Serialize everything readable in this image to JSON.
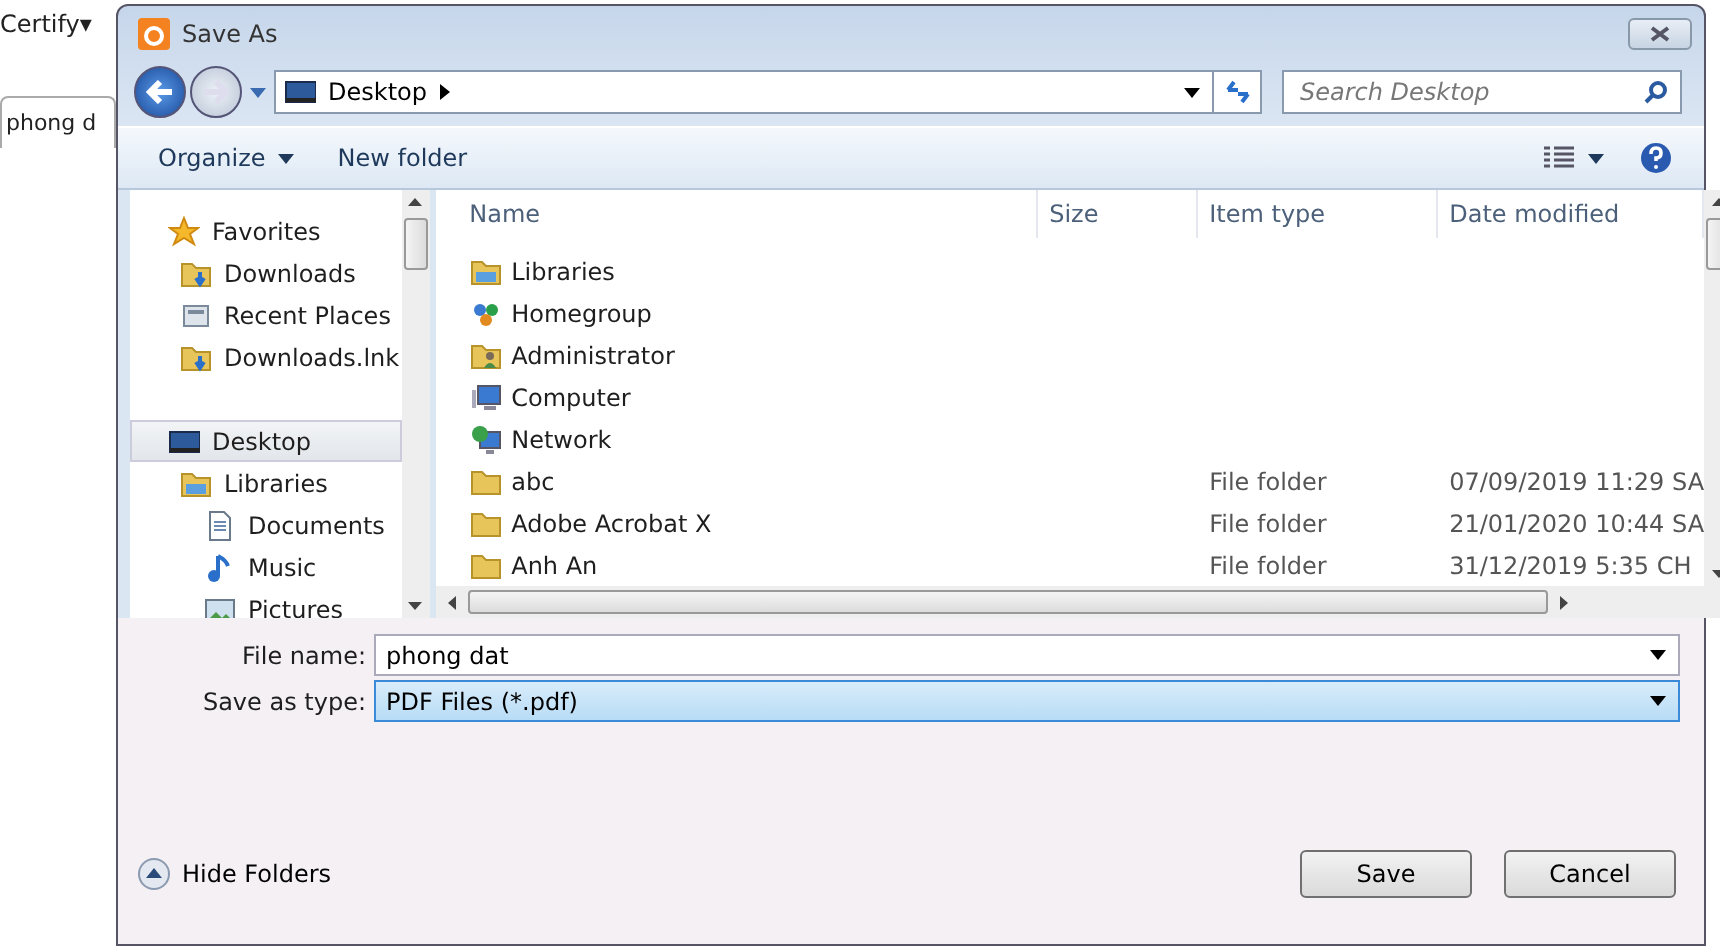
{
  "background_app": {
    "menu": "Certify▾",
    "tab": "phong d"
  },
  "window": {
    "title": "Save As"
  },
  "address_bar": {
    "location": "Desktop",
    "search": {
      "placeholder": "Search Desktop"
    }
  },
  "toolbar": {
    "items": [
      {
        "label": "Organize",
        "kind": "menu"
      },
      {
        "label": "New folder",
        "kind": "button"
      }
    ]
  },
  "sidebar": {
    "items": [
      {
        "label": "Favorites",
        "kind": "star",
        "selected": false,
        "children": [
          {
            "label": "Downloads",
            "kind": "download",
            "selected": false
          },
          {
            "label": "Recent Places",
            "kind": "recent",
            "selected": false
          },
          {
            "label": "Downloads.lnk",
            "kind": "download",
            "selected": false
          }
        ]
      },
      {
        "label": "Desktop",
        "kind": "desktop",
        "selected": true,
        "children": [
          {
            "label": "Libraries",
            "kind": "library",
            "selected": false,
            "children": [
              {
                "label": "Documents",
                "kind": "document",
                "selected": false
              },
              {
                "label": "Music",
                "kind": "music",
                "selected": false
              },
              {
                "label": "Pictures",
                "kind": "picture",
                "selected": false
              }
            ]
          }
        ]
      }
    ]
  },
  "table": {
    "columns": [
      "Name",
      "Size",
      "Item type",
      "Date modified"
    ],
    "rows": [
      {
        "kind": "library",
        "name": "Libraries",
        "size": "",
        "type": "",
        "date": ""
      },
      {
        "kind": "homegroup",
        "name": "Homegroup",
        "size": "",
        "type": "",
        "date": ""
      },
      {
        "kind": "user",
        "name": "Administrator",
        "size": "",
        "type": "",
        "date": ""
      },
      {
        "kind": "computer",
        "name": "Computer",
        "size": "",
        "type": "",
        "date": ""
      },
      {
        "kind": "network",
        "name": "Network",
        "size": "",
        "type": "",
        "date": ""
      },
      {
        "kind": "folder",
        "name": "abc",
        "size": "",
        "type": "File folder",
        "date": "07/09/2019 11:29 SA"
      },
      {
        "kind": "folder",
        "name": "Adobe Acrobat X",
        "size": "",
        "type": "File folder",
        "date": "21/01/2020 10:44 SA"
      },
      {
        "kind": "folder",
        "name": "Anh An",
        "size": "",
        "type": "File folder",
        "date": "31/12/2019 5:35 CH"
      }
    ]
  },
  "form": {
    "file_name": {
      "label": "File name:",
      "value": "phong dat"
    },
    "save_as_type": {
      "label": "Save as type:",
      "value": "PDF Files (*.pdf)"
    }
  },
  "footer": {
    "toggle": "Hide Folders",
    "buttons": [
      "Save",
      "Cancel"
    ]
  }
}
